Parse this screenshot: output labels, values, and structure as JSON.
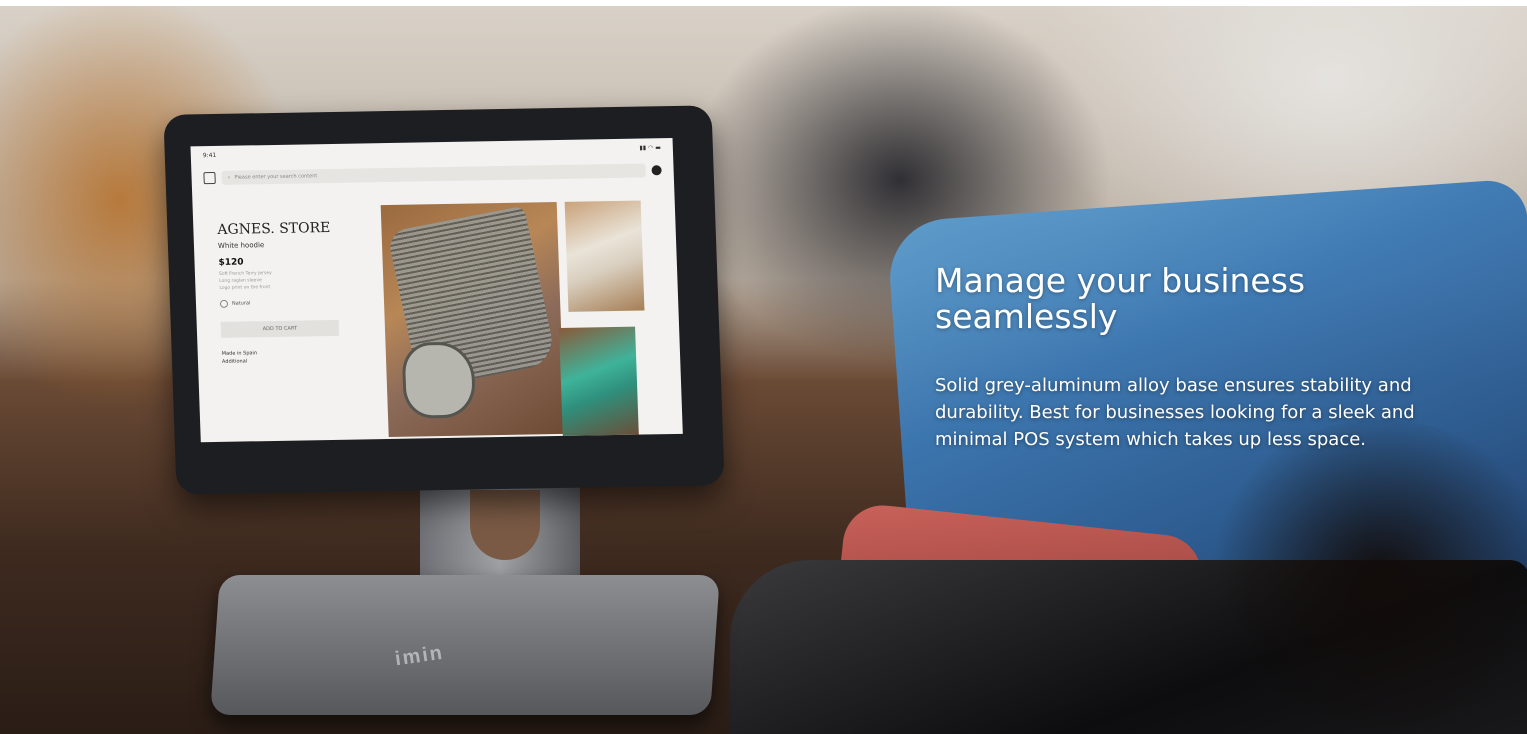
{
  "hero": {
    "headline": "Manage your business seamlessly",
    "description": "Solid grey-aluminum alloy base ensures stability and durability. Best for businesses looking for a sleek and minimal POS system which takes up less space.",
    "brand_mark": "imin"
  },
  "tablet_screen": {
    "status_time": "9:41",
    "status_icons": "signal wifi battery",
    "search_placeholder": "Please enter your search content",
    "store_name": "AGNES. STORE",
    "product_subtitle": "White hoodie",
    "price": "$120",
    "features": [
      "Soft French Terry jersey",
      "Long raglan sleeve",
      "Logo print on the front"
    ],
    "color_option": "Natural",
    "add_to_cart_label": "ADD TO CART",
    "meta_lines": [
      "Made in Spain",
      "Additional"
    ]
  },
  "icons": {
    "home": "home-icon",
    "search": "search-icon",
    "edit": "edit-icon"
  }
}
